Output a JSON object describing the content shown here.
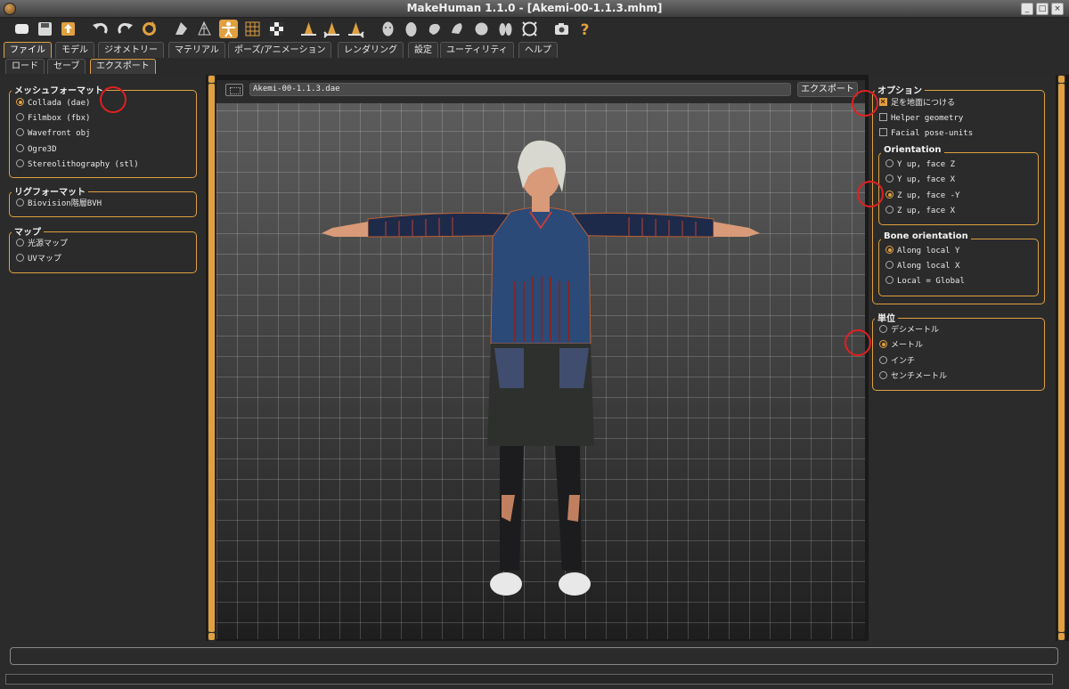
{
  "window": {
    "title": "MakeHuman 1.1.0 - [Akemi-00-1.1.3.mhm]"
  },
  "toolbar": {
    "icons": [
      "new-file-icon",
      "save-icon",
      "export-icon",
      "undo-icon",
      "redo-icon",
      "reset-icon",
      "smooth-icon",
      "wireframe-icon",
      "pose-icon",
      "grid-icon",
      "checker-icon",
      "front-view-icon",
      "back-view-icon",
      "side-view-icon",
      "head-icon",
      "egg-icon",
      "hand-icon",
      "foot-icon",
      "sphere-icon",
      "lungs-icon",
      "reset-camera-icon",
      "screenshot-icon",
      "help-icon"
    ],
    "help_glyph": "?"
  },
  "tabs": [
    "ファイル",
    "モデル",
    "ジオメトリー",
    "マテリアル",
    "ポーズ/アニメーション",
    "レンダリング",
    "設定",
    "ユーティリティ",
    "ヘルプ"
  ],
  "subtabs": [
    "ロード",
    "セーブ",
    "エクスポート"
  ],
  "left": {
    "mesh_format": {
      "title": "メッシュフォーマット",
      "options": [
        "Collada (dae)",
        "Filmbox (fbx)",
        "Wavefront obj",
        "Ogre3D",
        "Stereolithography (stl)"
      ],
      "selected": 0
    },
    "rig_format": {
      "title": "リグフォーマット",
      "options": [
        "Biovision階層BVH"
      ]
    },
    "maps": {
      "title": "マップ",
      "options": [
        "光源マップ",
        "UVマップ"
      ]
    }
  },
  "filebar": {
    "filename": "Akemi-00-1.1.3.dae",
    "export_label": "エクスポート"
  },
  "right": {
    "options": {
      "title": "オプション",
      "checks": [
        {
          "label": "足を地面につける",
          "checked": true
        },
        {
          "label": "Helper geometry",
          "checked": false
        },
        {
          "label": "Facial pose-units",
          "checked": false
        }
      ]
    },
    "orientation": {
      "title": "Orientation",
      "options": [
        "Y up, face Z",
        "Y up, face X",
        "Z up, face -Y",
        "Z up, face X"
      ],
      "selected": 2
    },
    "bone_orientation": {
      "title": "Bone orientation",
      "options": [
        "Along local Y",
        "Along local X",
        "Local = Global"
      ],
      "selected": 0
    },
    "units": {
      "title": "単位",
      "options": [
        "デシメートル",
        "メートル",
        "インチ",
        "センチメートル"
      ],
      "selected": 1
    }
  },
  "colors": {
    "accent": "#e0a040",
    "panel": "#2b2b2b",
    "marker": "#e02020"
  }
}
